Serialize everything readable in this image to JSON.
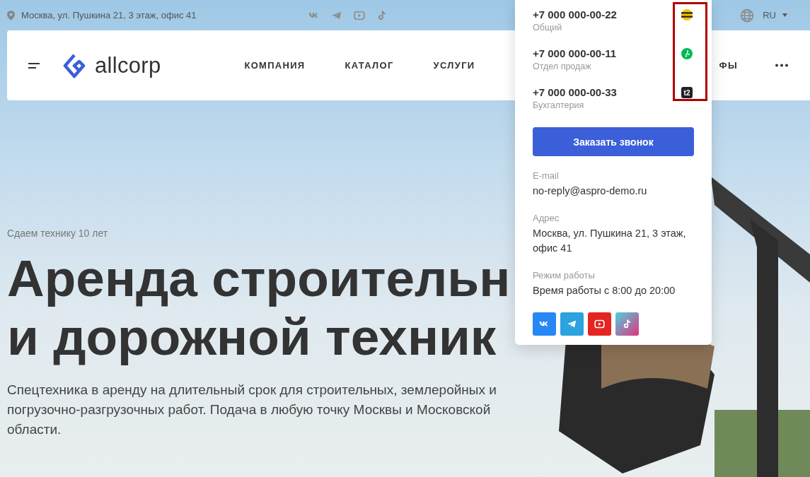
{
  "top_bar": {
    "address": "Москва, ул. Пушкина 21, 3 этаж, офис 41",
    "socials": [
      {
        "kind": "vk"
      },
      {
        "kind": "telegram"
      },
      {
        "kind": "youtube"
      },
      {
        "kind": "tiktok"
      }
    ],
    "language": "RU"
  },
  "header": {
    "logo_text": "allcorp",
    "nav_items": [
      "КОМПАНИЯ",
      "КАТАЛОГ",
      "УСЛУГИ",
      "ФЫ"
    ]
  },
  "hero": {
    "eyebrow": "Сдаем технику 10 лет",
    "title_lines": [
      "Аренда строительн",
      "и дорожной техник"
    ],
    "description": "Спецтехника в аренду на длительный срок для строительных, землеройных и погрузочно-разгрузочных работ. Подача в любую точку Москвы и Московской области."
  },
  "contacts_popup": {
    "phones": [
      {
        "number": "+7 000 000-00-22",
        "label": "Общий",
        "kind": "beeline"
      },
      {
        "number": "+7 000 000-00-11",
        "label": "Отдел продаж",
        "kind": "megafon"
      },
      {
        "number": "+7 000 000-00-33",
        "label": "Бухгалтерия",
        "kind": "tele2",
        "logo_text": "t2"
      }
    ],
    "callback_button": "Заказать звонок",
    "fields": [
      {
        "label": "E-mail",
        "value": "no-reply@aspro-demo.ru"
      },
      {
        "label": "Адрес",
        "value": "Москва, ул. Пушкина 21, 3 этаж, офис 41"
      },
      {
        "label": "Режим работы",
        "value": "Время работы с 8:00 до 20:00"
      }
    ],
    "socials": [
      {
        "kind": "vk"
      },
      {
        "kind": "telegram"
      },
      {
        "kind": "youtube"
      },
      {
        "kind": "tiktok"
      }
    ]
  }
}
